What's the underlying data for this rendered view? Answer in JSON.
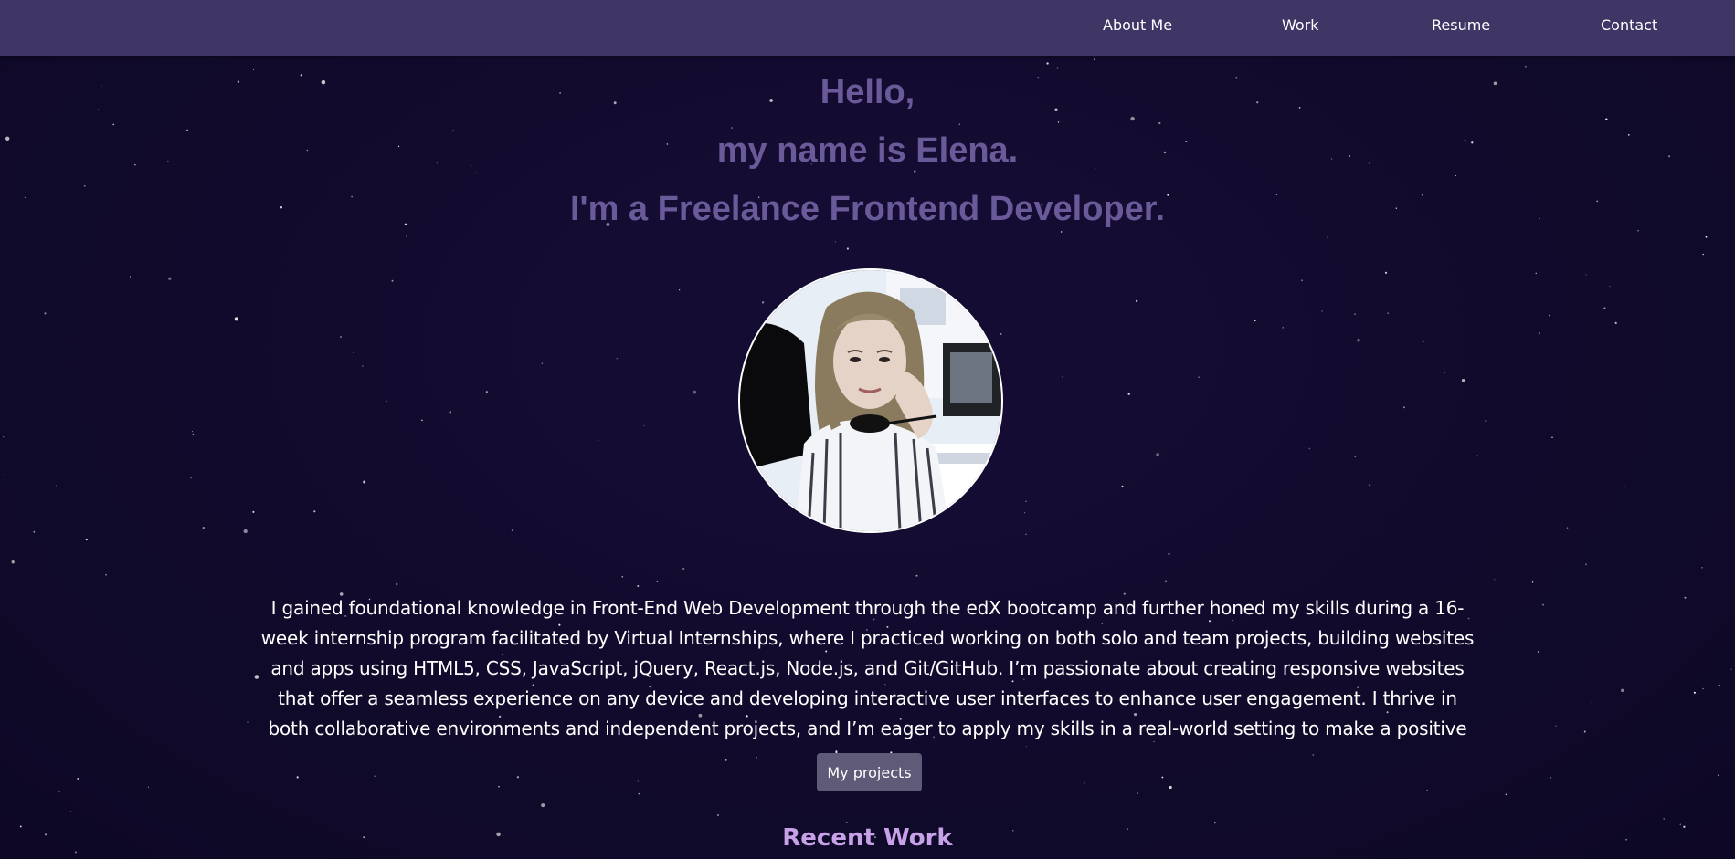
{
  "nav": {
    "items": [
      {
        "label": "About Me"
      },
      {
        "label": "Work"
      },
      {
        "label": "Resume"
      },
      {
        "label": "Contact"
      }
    ]
  },
  "hero": {
    "line1": "Hello,",
    "line2": "my name is Elena.",
    "line3": "I'm a Freelance Frontend Developer."
  },
  "about": {
    "text": "I gained foundational knowledge in Front-End Web Development through the edX bootcamp and further honed my skills during a 16-week internship program facilitated by Virtual Internships, where I practiced working on both solo and team projects, building websites and apps using HTML5, CSS, JavaScript, jQuery, React.js, Node.js, and Git/GitHub. I’m passionate about creating responsive websites that offer a seamless experience on any device and developing interactive user interfaces to enhance user engagement. I thrive in both collaborative environments and independent projects, and I’m eager to apply my skills in a real-world setting to make a positive impact."
  },
  "cta": {
    "projects_label": "My projects"
  },
  "recent": {
    "title": "Recent Work"
  },
  "colors": {
    "navbar": "#3f3666",
    "background": "#120a2e",
    "hero_text": "#6a5a99",
    "accent": "#c8a2e8",
    "button": "#5f5a78"
  }
}
